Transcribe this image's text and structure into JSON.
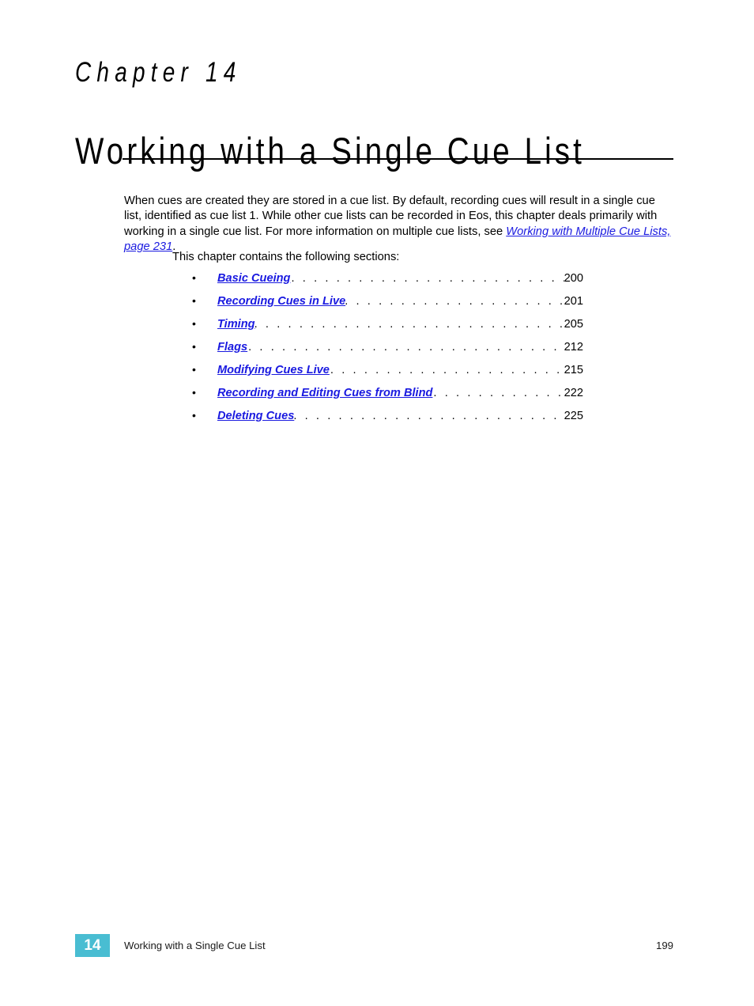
{
  "chapter": {
    "eyebrow": "Chapter 14",
    "title": "Working with a Single Cue List"
  },
  "intro": {
    "text_before_link": "When cues are created they are stored in a cue list. By default, recording cues will result in a single cue list, identified as cue list 1. While other cue lists can be recorded in Eos, this chapter deals primarily with working in a single cue list. For more information on multiple cue lists, see ",
    "link_text": "Working with Multiple Cue Lists, page 231",
    "text_after_link": ".",
    "link_color": "#1a1ae0"
  },
  "leadin": "This chapter contains the following sections:",
  "toc": {
    "bullet": "•",
    "items": [
      {
        "label": "Basic Cueing",
        "page": "200",
        "dots": ". . . . . . . . . . . . . . . . . . . . . . . . . . . . . . . . . . . . . ."
      },
      {
        "label": "Recording Cues in Live",
        "page": "201",
        "dots": ". . . . . . . . . . . . . . . . . . . . . . . . . . . . ."
      },
      {
        "label": "Timing",
        "page": "205",
        "dots": ". . . . . . . . . . . . . . . . . . . . . . . . . . . . . . . . . . . . . . . . . . . ."
      },
      {
        "label": "Flags",
        "page": "212",
        "dots": ". . . . . . . . . . . . . . . . . . . . . . . . . . . . . . . . . . . . . . . . . . . . ."
      },
      {
        "label": "Modifying Cues Live",
        "page": "215",
        "dots": ". . . . . . . . . . . . . . . . . . . . . . . . . . . . . ."
      },
      {
        "label": "Recording and Editing Cues from Blind",
        "page": "222",
        "dots": ". . . . . . . . . . . . . ."
      },
      {
        "label": "Deleting Cues",
        "page": "225",
        "dots": ". . . . . . . . . . . . . . . . . . . . . . . . . . . . . . . . . . . ."
      }
    ]
  },
  "footer": {
    "chapter_number": "14",
    "title": "Working with a Single Cue List",
    "page_number": "199",
    "chip_color": "#49bdd2"
  }
}
